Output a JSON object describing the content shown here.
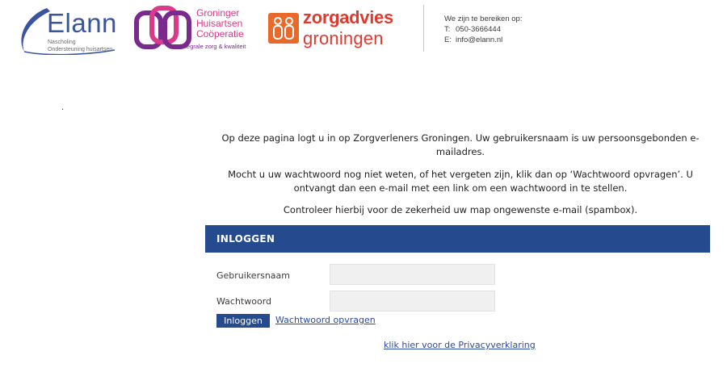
{
  "header": {
    "elann": {
      "word": "Elann",
      "sub_line1": "Nascholing",
      "sub_line2": "Ondersteuning huisartsen"
    },
    "ghc": {
      "line1": "Groninger",
      "line2": "Huisartsen",
      "line3": "Coöperatie",
      "tagline": "integrale zorg & kwaliteit"
    },
    "zorgadvies": {
      "line1": "zorgadvies",
      "line2": "groningen"
    },
    "contact": {
      "heading": "We zijn te bereiken op:",
      "phone_label": "T:",
      "phone": "050-3666444",
      "email_label": "E:",
      "email": "info@elann.nl"
    }
  },
  "page": {
    "dot": ".",
    "intro1": "Op deze pagina logt u in op Zorgverleners Groningen. Uw gebruikersnaam is uw persoonsgebonden e-mailadres.",
    "intro2": "Mocht u uw wachtwoord nog niet weten, of het vergeten zijn, klik dan op ‘Wachtwoord opvragen’. U ontvangt dan een e-mail met een link om een wachtwoord in te stellen.",
    "intro3": "Controleer hierbij voor de zekerheid uw map ongewenste e-mail (spambox)."
  },
  "login": {
    "title": "INLOGGEN",
    "username_label": "Gebruikersnaam",
    "username_value": "",
    "password_label": "Wachtwoord",
    "password_value": "",
    "submit_label": "Inloggen",
    "forgot_link": "Wachtwoord opvragen",
    "privacy_link": "klik hier voor de Privacyverklaring"
  },
  "colors": {
    "primary": "#264a8e",
    "elann_blue": "#3a55a0",
    "ghc_magenta": "#d93a8a",
    "ghc_purple": "#7a2a8c",
    "zorg_orange": "#e03a2f",
    "link": "#2b4c9a",
    "input_bg": "#f0f0f0"
  },
  "icons": [
    "elann-swoosh-icon",
    "ghc-knot-icon",
    "zorgadvies-people-icon"
  ]
}
